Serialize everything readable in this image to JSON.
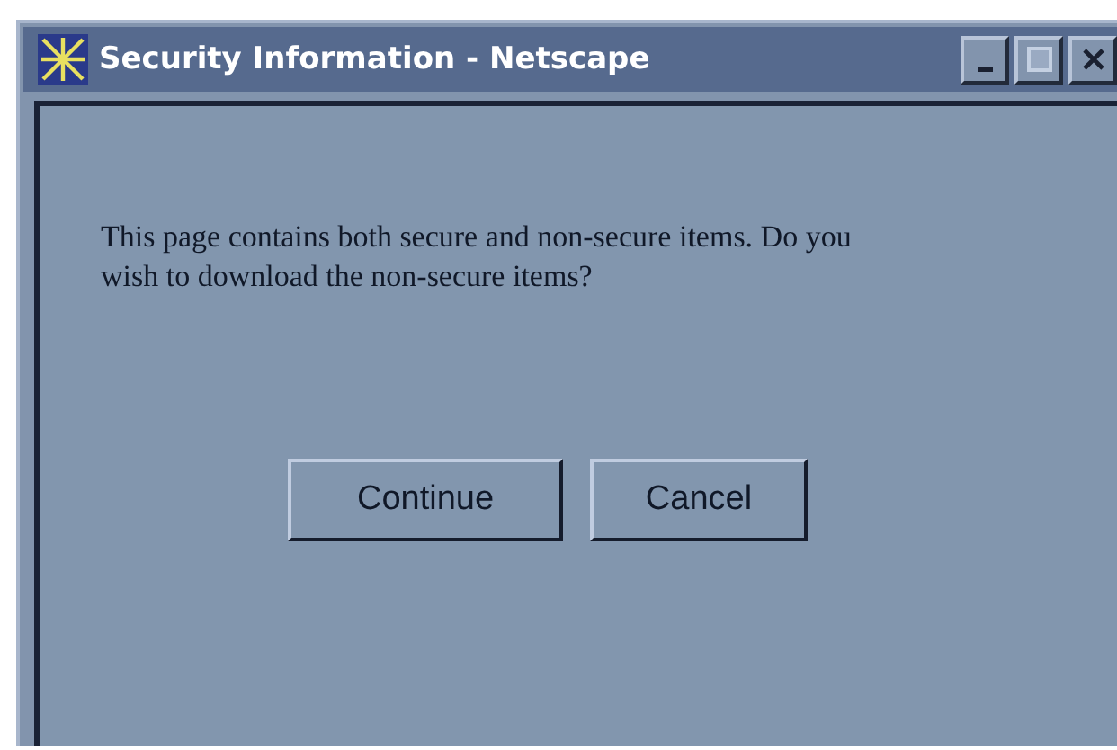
{
  "window": {
    "title": "Security Information - Netscape"
  },
  "message": "This page contains both secure and non-secure items. Do you wish to download the non-secure items?",
  "buttons": [
    "Continue",
    "Cancel"
  ]
}
